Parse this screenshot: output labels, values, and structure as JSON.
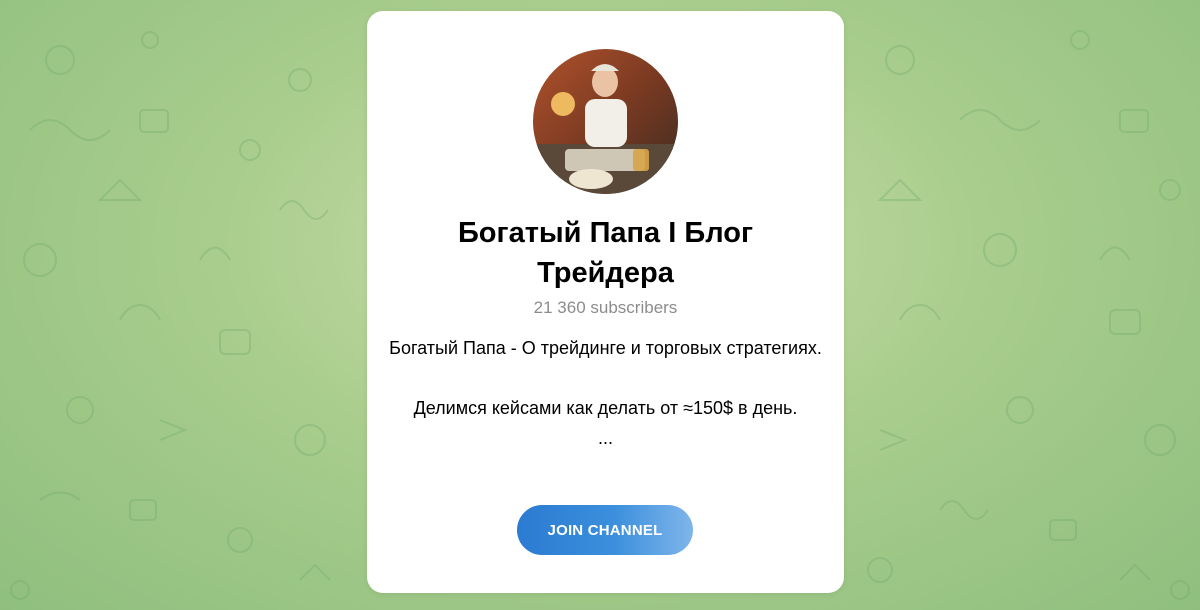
{
  "channel": {
    "title": "Богатый Папа I Блог Трейдера",
    "subscribers": "21 360 subscribers",
    "description_lines": [
      "Богатый Папа - О трейдинге и торговых стратегиях.",
      "Делимся кейсами как делать от ≈150$ в день.",
      "..."
    ],
    "avatar_icon": "channel-avatar-photo"
  },
  "join_button": {
    "label": "JOIN CHANNEL"
  },
  "colors": {
    "background": "#a9cd8d",
    "card": "#ffffff",
    "button": "#2b7bd2",
    "subscribers_text": "#8c8c8c"
  }
}
